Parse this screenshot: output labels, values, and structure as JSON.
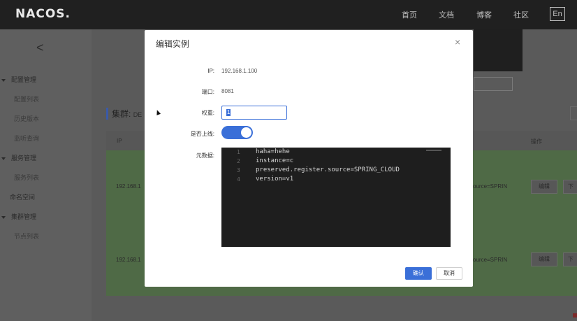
{
  "app": {
    "logo": "NACOS."
  },
  "topnav": {
    "items": [
      "首页",
      "文档",
      "博客",
      "社区"
    ],
    "lang": "En"
  },
  "sidebar": {
    "back": "<",
    "groups": [
      {
        "label": "配置管理",
        "items": [
          "配置列表",
          "历史版本",
          "监听查询"
        ]
      },
      {
        "label": "服务管理",
        "items": [
          "服务列表"
        ]
      },
      {
        "label": "命名空间",
        "items": []
      },
      {
        "label": "集群管理",
        "items": [
          "节点列表"
        ]
      }
    ]
  },
  "cluster": {
    "title": "集群:",
    "name": "DE"
  },
  "table": {
    "headers": {
      "ip": "IP",
      "ops": "操作"
    },
    "rows": [
      {
        "ip": "192.168.1",
        "meta": "ource=SPRIN",
        "edit": "编辑",
        "more": "下"
      },
      {
        "ip": "192.168.1",
        "meta": "ource=SPRIN",
        "edit": "编辑",
        "more": "下"
      }
    ]
  },
  "modal": {
    "title": "编辑实例",
    "close": "×",
    "fields": {
      "ip_label": "IP:",
      "ip_value": "192.168.1.100",
      "port_label": "端口:",
      "port_value": "8081",
      "weight_label": "权重:",
      "weight_value": "1",
      "online_label": "是否上线:",
      "meta_label": "元数据:"
    },
    "metadata_lines": [
      {
        "n": "1",
        "text": "haha=hehe"
      },
      {
        "n": "2",
        "text": "instance=c"
      },
      {
        "n": "3",
        "text": "preserved.register.source=SPRING_CLOUD"
      },
      {
        "n": "4",
        "text": "version=v1"
      }
    ],
    "confirm": "确认",
    "cancel": "取消"
  },
  "colors": {
    "primary": "#3a6fd8",
    "editor_bg": "#1e1e1e"
  }
}
